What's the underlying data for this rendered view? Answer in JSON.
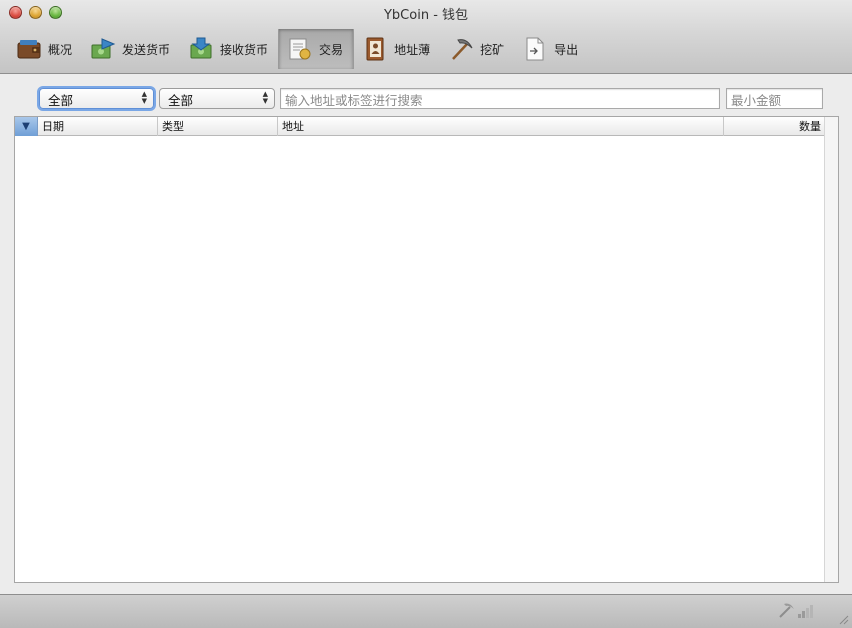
{
  "window": {
    "title": "YbCoin - 钱包"
  },
  "toolbar": {
    "items": [
      {
        "label": "概况",
        "icon": "wallet-icon"
      },
      {
        "label": "发送货币",
        "icon": "send-coins-icon"
      },
      {
        "label": "接收货币",
        "icon": "receive-coins-icon"
      },
      {
        "label": "交易",
        "icon": "transactions-icon"
      },
      {
        "label": "地址薄",
        "icon": "address-book-icon"
      },
      {
        "label": "挖矿",
        "icon": "pickaxe-icon"
      },
      {
        "label": "导出",
        "icon": "export-icon"
      }
    ],
    "active_index": 3
  },
  "filters": {
    "date_filter": {
      "selected": "全部"
    },
    "type_filter": {
      "selected": "全部"
    },
    "search": {
      "placeholder": "输入地址或标签进行搜索",
      "value": ""
    },
    "min_amount": {
      "placeholder": "最小金额",
      "value": ""
    }
  },
  "table": {
    "columns": [
      {
        "key": "status",
        "label": "▼"
      },
      {
        "key": "date",
        "label": "日期"
      },
      {
        "key": "type",
        "label": "类型"
      },
      {
        "key": "address",
        "label": "地址"
      },
      {
        "key": "amount",
        "label": "数量"
      }
    ],
    "rows": []
  },
  "statusbar": {
    "icons": [
      "mining-status-icon",
      "connection-signal-icon"
    ]
  },
  "colors": {
    "focus_ring": "#7aa7e6",
    "active_tool": "#b0b0b0",
    "header_sort": "#6f9fd6"
  }
}
